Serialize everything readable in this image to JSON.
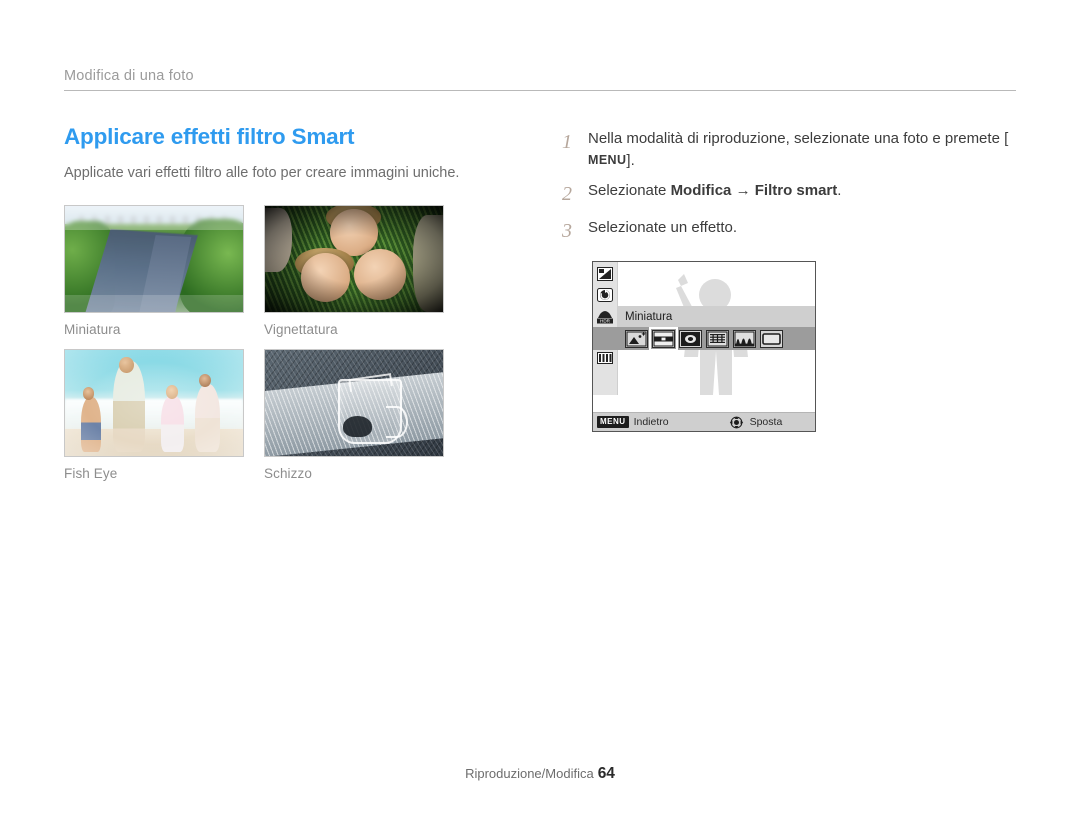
{
  "header": {
    "breadcrumb": "Modifica di una foto"
  },
  "left": {
    "title": "Applicare effetti filtro Smart",
    "intro": "Applicate vari effetti filtro alle foto per creare immagini uniche.",
    "samples": [
      {
        "caption": "Miniatura",
        "style": "ph-mini",
        "alt": "Strada con alberi verdi, effetto miniatura"
      },
      {
        "caption": "Vignettatura",
        "style": "ph-vign",
        "alt": "Tre persone sull'erba, effetto vignettatura"
      },
      {
        "caption": "Fish Eye",
        "style": "ph-fish",
        "alt": "Famiglia sulla spiaggia, effetto fish eye"
      },
      {
        "caption": "Schizzo",
        "style": "ph-sketch",
        "alt": "Brocca di vetro, effetto schizzo"
      }
    ]
  },
  "right": {
    "steps": [
      {
        "num": "1",
        "pre": "Nella modalità di riproduzione, selezionate una foto e premete [",
        "key": "MENU",
        "post": "]."
      },
      {
        "num": "2",
        "pre": "Selezionate ",
        "bold1": "Modifica",
        "arrow": " → ",
        "bold2": "Filtro smart",
        "post": "."
      },
      {
        "num": "3",
        "pre": "Selezionate un effetto.",
        "key": "",
        "post": ""
      }
    ]
  },
  "lcd": {
    "selected_label": "Miniatura",
    "rail_icons": [
      {
        "name": "resize-icon",
        "selected": false
      },
      {
        "name": "rotate-icon",
        "selected": false
      },
      {
        "name": "acb-hdr-icon",
        "selected": false
      },
      {
        "name": "smart-filter-icon",
        "selected": true
      },
      {
        "name": "adjust-icon",
        "selected": false
      }
    ],
    "effect_icons": [
      {
        "name": "smart-filter-off-icon",
        "active": false
      },
      {
        "name": "normal-icon",
        "active": false
      },
      {
        "name": "miniature-icon",
        "active": true
      },
      {
        "name": "vignette-icon",
        "active": false
      },
      {
        "name": "halftone-dot-icon",
        "active": false
      },
      {
        "name": "fish-eye-icon",
        "active": false
      },
      {
        "name": "sketch-icon",
        "active": false
      }
    ],
    "footer": {
      "menu_chip": "MENU",
      "back_label": "Indietro",
      "move_label": "Sposta"
    }
  },
  "footer": {
    "section": "Riproduzione/Modifica",
    "page": "64"
  },
  "colors": {
    "accent_blue": "#2f9bef",
    "step_number": "#b6a79c",
    "caption_grey": "#8d8d8d",
    "rule_grey": "#b9b9b9"
  }
}
